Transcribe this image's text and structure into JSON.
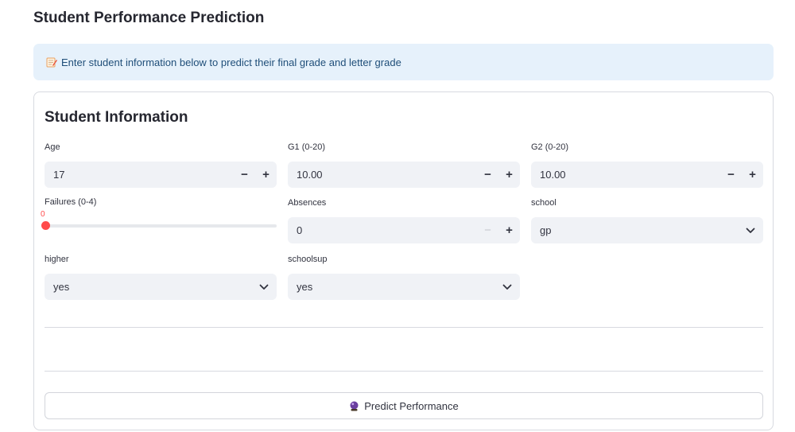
{
  "page": {
    "title": "Student Performance Prediction",
    "info_text": "Enter student information below to predict their final grade and letter grade",
    "info_icon": "memo-icon"
  },
  "form": {
    "title": "Student Information",
    "age": {
      "label": "Age",
      "value": "17"
    },
    "g1": {
      "label": "G1 (0-20)",
      "value": "10.00"
    },
    "g2": {
      "label": "G2 (0-20)",
      "value": "10.00"
    },
    "failures": {
      "label": "Failures (0-4)",
      "value": "0",
      "min": 0,
      "max": 4
    },
    "absences": {
      "label": "Absences",
      "value": "0"
    },
    "school": {
      "label": "school",
      "value": "gp"
    },
    "higher": {
      "label": "higher",
      "value": "yes"
    },
    "schoolsup": {
      "label": "schoolsup",
      "value": "yes"
    },
    "stepper": {
      "minus": "−",
      "plus": "+"
    },
    "predict_button": {
      "label": "Predict Performance",
      "icon": "crystal-ball-icon"
    }
  },
  "colors": {
    "accent": "#ff4b4b",
    "info_bg": "#e6f1fb",
    "info_text": "#1f4e79",
    "input_bg": "#f0f2f6"
  }
}
